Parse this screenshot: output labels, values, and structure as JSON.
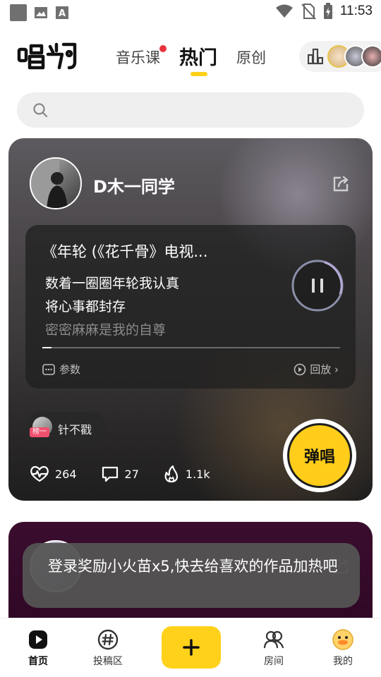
{
  "status_bar": {
    "time": "11:53",
    "left_icons": [
      "app-square-icon",
      "image-icon",
      "font-icon"
    ],
    "right_icons": [
      "wifi-icon",
      "no-sim-icon",
      "battery-charging-icon"
    ]
  },
  "header": {
    "logo_text": "唱鸭",
    "tabs": [
      {
        "label": "音乐课",
        "badge": true
      },
      {
        "label": "热门",
        "active": true
      },
      {
        "label": "原创"
      }
    ],
    "rank_icon": "chart-bars-icon"
  },
  "search": {
    "placeholder": "",
    "icon": "search-icon"
  },
  "feed": {
    "card1": {
      "username": "D木一同学",
      "song_title": "《年轮 (《花千骨》电视...",
      "lyrics": [
        "数着一圈圈年轮我认真",
        "将心事都封存",
        "密密麻麻是我的自尊"
      ],
      "progress": 0.03,
      "param_label": "参数",
      "replay_label": "回放 ›",
      "gift": {
        "badge": "榜一",
        "name": "针不戳"
      },
      "stats": {
        "likes": "264",
        "comments": "27",
        "heat": "1.1k"
      },
      "sing_button": "弹唱",
      "colors": {
        "sing_button": "#ffcd1a"
      }
    }
  },
  "toast": {
    "message": "登录奖励小火苗x5,快去给喜欢的作品加热吧"
  },
  "bottom_nav": [
    {
      "label": "首页",
      "icon": "play-square-icon",
      "active": true
    },
    {
      "label": "投稿区",
      "icon": "hashtag-icon"
    },
    {
      "label": "",
      "icon": "plus-icon"
    },
    {
      "label": "房间",
      "icon": "people-icon"
    },
    {
      "label": "我的",
      "icon": "duck-avatar-icon"
    }
  ],
  "colors": {
    "accent": "#ffd11a",
    "badge_red": "#e8333c",
    "card_dark": "#2a2828"
  }
}
